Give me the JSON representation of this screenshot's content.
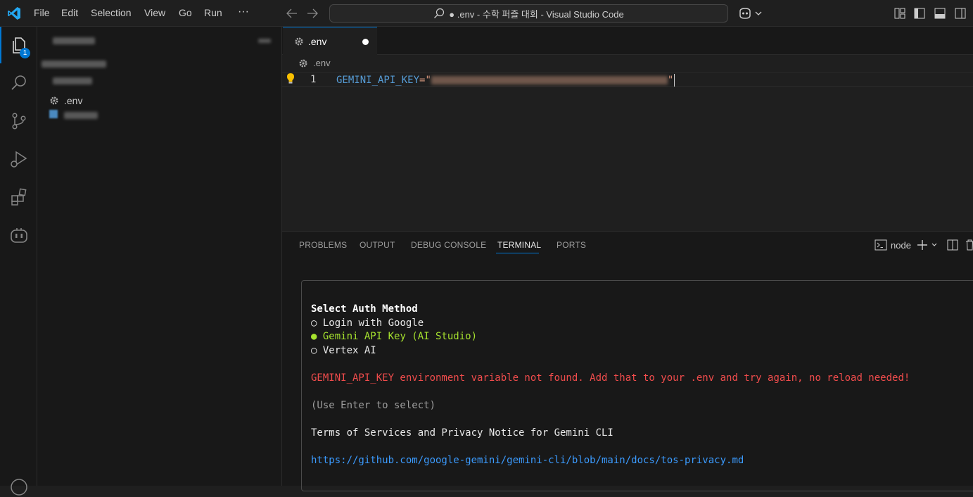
{
  "menu": [
    "File",
    "Edit",
    "Selection",
    "View",
    "Go",
    "Run"
  ],
  "menu_more": "···",
  "title": "● .env - 수학 퍼즐 대회 - Visual Studio Code",
  "activity": {
    "explorer_badge": "1"
  },
  "sidebar": {
    "env_file": ".env"
  },
  "editor": {
    "tab_label": ".env",
    "breadcrumb": ".env",
    "line_number": "1",
    "key": "GEMINI_API_KEY",
    "eq_quote": "=\"",
    "close_quote": "\""
  },
  "panel": {
    "tabs": [
      "PROBLEMS",
      "OUTPUT",
      "DEBUG CONSOLE",
      "TERMINAL",
      "PORTS"
    ],
    "active_tab": "TERMINAL",
    "terminal_name": "node"
  },
  "terminal": {
    "heading": "Select Auth Method",
    "options": [
      {
        "marker": "○",
        "label": "Login with Google"
      },
      {
        "marker": "●",
        "label": "Gemini API Key (AI Studio)"
      },
      {
        "marker": "○",
        "label": "Vertex AI"
      }
    ],
    "error": "GEMINI_API_KEY environment variable not found. Add that to your .env and try again, no reload needed!",
    "hint": "(Use Enter to select)",
    "terms": "Terms of Services and Privacy Notice for Gemini CLI",
    "link": "https://github.com/google-gemini/gemini-cli/blob/main/docs/tos-privacy.md"
  },
  "colors": {
    "accent": "#0078d4",
    "selected_option": "#a6e22e",
    "error": "#f14c4c",
    "link": "#3b9bff"
  }
}
